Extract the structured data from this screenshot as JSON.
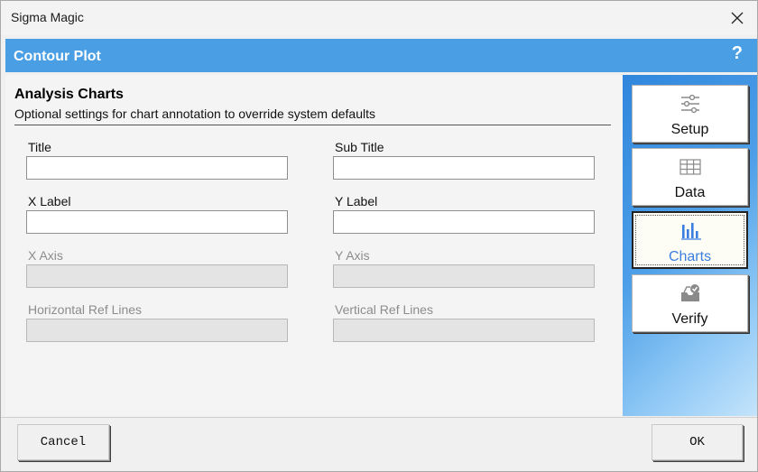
{
  "window": {
    "title": "Sigma Magic"
  },
  "header": {
    "title": "Contour Plot",
    "help": "?"
  },
  "section": {
    "title": "Analysis Charts",
    "description": "Optional settings for chart annotation to override system defaults"
  },
  "fields": {
    "title": {
      "label": "Title",
      "value": ""
    },
    "sub_title": {
      "label": "Sub Title",
      "value": ""
    },
    "x_label": {
      "label": "X Label",
      "value": ""
    },
    "y_label": {
      "label": "Y Label",
      "value": ""
    },
    "x_axis": {
      "label": "X Axis",
      "value": ""
    },
    "y_axis": {
      "label": "Y Axis",
      "value": ""
    },
    "h_ref_lines": {
      "label": "Horizontal Ref Lines",
      "value": ""
    },
    "v_ref_lines": {
      "label": "Vertical Ref Lines",
      "value": ""
    }
  },
  "sidebar": {
    "items": [
      {
        "label": "Setup",
        "icon": "sliders-icon"
      },
      {
        "label": "Data",
        "icon": "table-icon"
      },
      {
        "label": "Charts",
        "icon": "bar-chart-icon",
        "active": true
      },
      {
        "label": "Verify",
        "icon": "verify-icon"
      }
    ]
  },
  "buttons": {
    "cancel": "Cancel",
    "ok": "OK"
  },
  "colors": {
    "header": "#4a9ee4",
    "active_label": "#3b7ee0"
  }
}
